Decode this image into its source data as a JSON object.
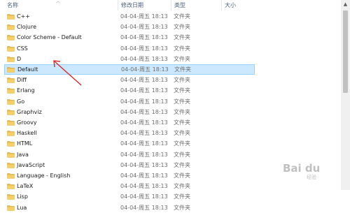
{
  "header": {
    "name": "名称",
    "modified": "修改日期",
    "type": "类型",
    "size": "大小"
  },
  "folder_icon": "folder-icon",
  "files": [
    {
      "name": "C++",
      "date": "04-04-周五 18:13",
      "type": "文件夹"
    },
    {
      "name": "Clojure",
      "date": "04-04-周五 18:13",
      "type": "文件夹"
    },
    {
      "name": "Color Scheme - Default",
      "date": "04-04-周五 18:13",
      "type": "文件夹"
    },
    {
      "name": "CSS",
      "date": "04-04-周五 18:13",
      "type": "文件夹"
    },
    {
      "name": "D",
      "date": "04-04-周五 18:13",
      "type": "文件夹"
    },
    {
      "name": "Default",
      "date": "04-04-周五 18:13",
      "type": "文件夹",
      "selected": true
    },
    {
      "name": "Diff",
      "date": "04-04-周五 18:13",
      "type": "文件夹"
    },
    {
      "name": "Erlang",
      "date": "04-04-周五 18:13",
      "type": "文件夹"
    },
    {
      "name": "Go",
      "date": "04-04-周五 18:13",
      "type": "文件夹"
    },
    {
      "name": "Graphviz",
      "date": "04-04-周五 18:13",
      "type": "文件夹"
    },
    {
      "name": "Groovy",
      "date": "04-04-周五 18:13",
      "type": "文件夹"
    },
    {
      "name": "Haskell",
      "date": "04-04-周五 18:13",
      "type": "文件夹"
    },
    {
      "name": "HTML",
      "date": "04-04-周五 18:13",
      "type": "文件夹"
    },
    {
      "name": "Java",
      "date": "04-04-周五 18:13",
      "type": "文件夹"
    },
    {
      "name": "JavaScript",
      "date": "04-04-周五 18:13",
      "type": "文件夹"
    },
    {
      "name": "Language - English",
      "date": "04-04-周五 18:13",
      "type": "文件夹"
    },
    {
      "name": "LaTeX",
      "date": "04-04-周五 18:13",
      "type": "文件夹"
    },
    {
      "name": "Lisp",
      "date": "04-04-周五 18:13",
      "type": "文件夹"
    },
    {
      "name": "Lua",
      "date": "04-04-周五 18:13",
      "type": "文件夹"
    }
  ],
  "watermark": {
    "main": "Bai du",
    "sub": "经验",
    "url": "jingyan.baidu.com"
  },
  "colors": {
    "selection_bg": "#cce8ff",
    "selection_border": "#99d1ff",
    "folder": "#e8b948",
    "annotation_arrow": "#e0262a"
  }
}
